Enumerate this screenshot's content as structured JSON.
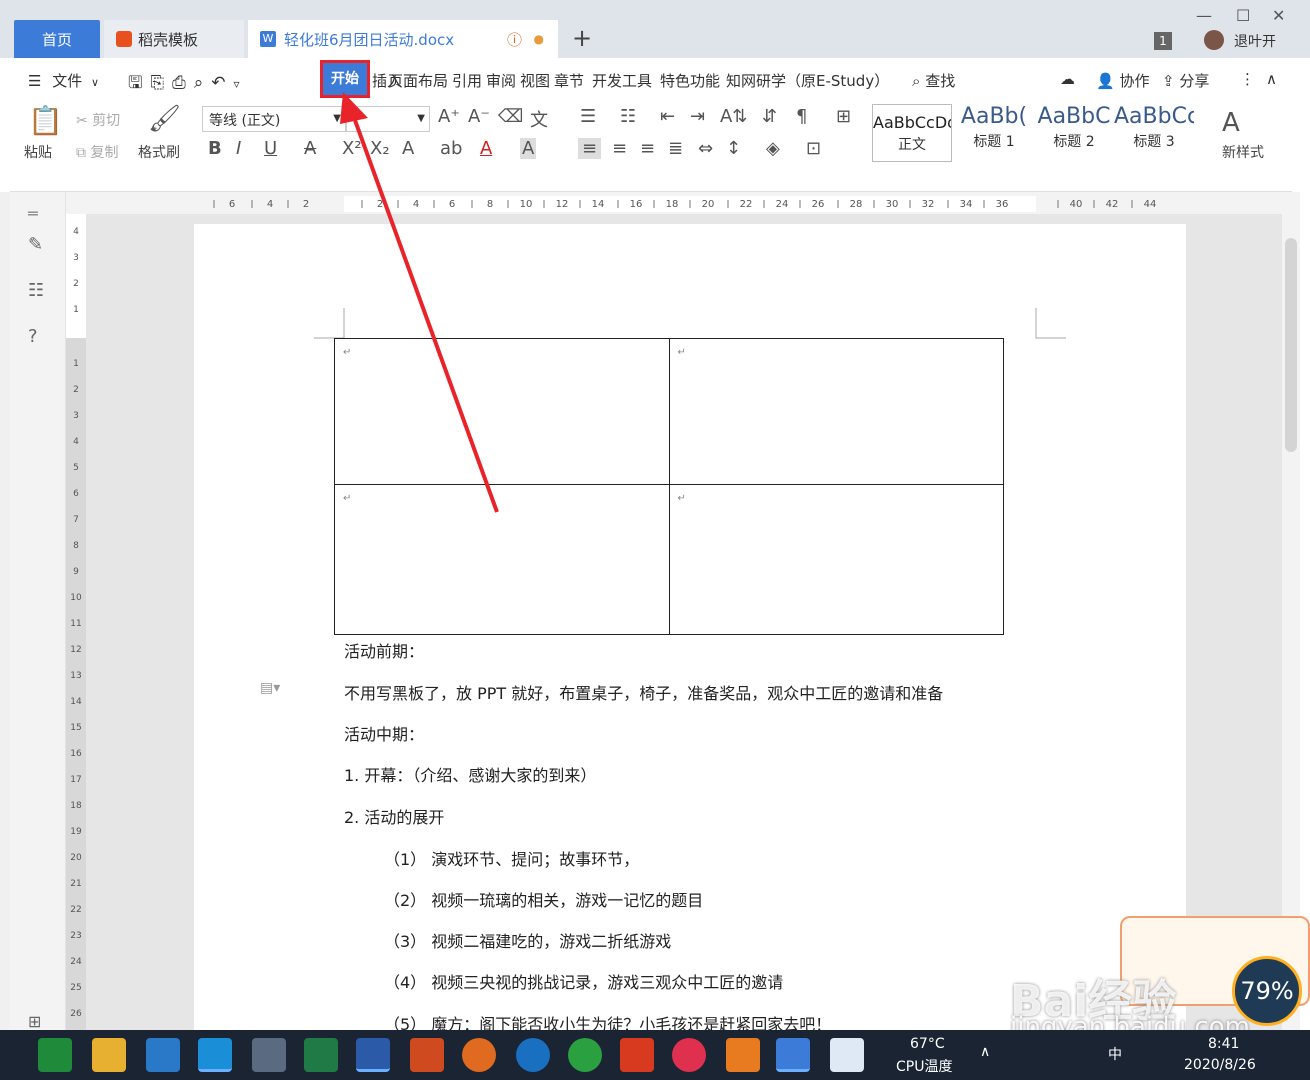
{
  "tabs": {
    "home": "首页",
    "templates": "稻壳模板",
    "document": "轻化班6月团日活动.docx",
    "new_tab": "+"
  },
  "window": {
    "badge": "1",
    "user": "退叶开"
  },
  "menu": {
    "file": "文件",
    "active": "开始",
    "items": [
      "插入",
      "页面布局",
      "引用",
      "审阅",
      "视图",
      "章节",
      "开发工具",
      "特色功能",
      "知网研学（原E-Study）"
    ],
    "search": "查找",
    "collab": "协作",
    "share": "分享"
  },
  "ribbon": {
    "paste": "粘贴",
    "cut": "剪切",
    "copy": "复制",
    "format_painter": "格式刷",
    "font_name": "等线 (正文)",
    "font_size": "",
    "styles": [
      {
        "sample": "AaBbCcDd",
        "label": "正文"
      },
      {
        "sample": "AaBb(",
        "label": "标题 1"
      },
      {
        "sample": "AaBbC",
        "label": "标题 2"
      },
      {
        "sample": "AaBbCc",
        "label": "标题 3"
      }
    ],
    "new_style": "新样式"
  },
  "ruler": {
    "h_ticks": [
      "6",
      "4",
      "2",
      "2",
      "4",
      "6",
      "8",
      "10",
      "12",
      "14",
      "16",
      "18",
      "20",
      "22",
      "24",
      "26",
      "28",
      "30",
      "32",
      "34",
      "36",
      "40",
      "42",
      "44"
    ],
    "v_ticks_top": [
      "4",
      "3",
      "2",
      "1"
    ],
    "v_ticks": [
      "1",
      "2",
      "3",
      "4",
      "5",
      "6",
      "7",
      "8",
      "9",
      "10",
      "11",
      "12",
      "13",
      "14",
      "15",
      "16",
      "17",
      "18",
      "19",
      "20",
      "21",
      "22",
      "23",
      "24",
      "25",
      "26"
    ]
  },
  "document": {
    "paragraphs": [
      "活动前期：",
      "不用写黑板了，放 PPT 就好，布置桌子，椅子，准备奖品，观众中工匠的邀请和准备",
      "活动中期：",
      "1. 开幕：（介绍、感谢大家的到来）",
      "2. 活动的展开",
      "（1） 演戏环节、提问；故事环节，",
      "（2） 视频一琉璃的相关，游戏一记忆的题目",
      "（3） 视频二福建吃的，游戏二折纸游戏",
      "（4） 视频三央视的挑战记录，游戏三观众中工匠的邀请",
      "（5） 魔方：阁下能否收小生为徒？小毛孩还是赶紧回家去吧！"
    ]
  },
  "taskbar": {
    "temp": "67°C",
    "temp_label": "CPU温度",
    "ime": "中",
    "time": "8:41",
    "date": "2020/8/26"
  },
  "watermark": {
    "brand": "Bai经验",
    "url": "jingyan.baidu.com",
    "percent": "79%"
  },
  "colors": {
    "accent": "#3d7bd9",
    "highlight": "#e8232a",
    "taskbar": "#1a2433"
  }
}
